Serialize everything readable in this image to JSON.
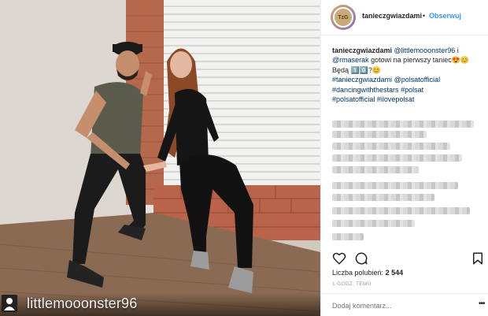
{
  "post": {
    "username": "tanieczgwiazdami",
    "dot": "•",
    "follow_label": "Obserwuj",
    "avatar_text": "TzG"
  },
  "caption": {
    "username": "tanieczgwiazdami",
    "mention1": "@littlemooonster96",
    "text1": " i ",
    "mention2": "@rmaserak",
    "text2": " gotowi na pierwszy taniec😍😊",
    "text3": "Będą 1️⃣0️⃣?😊",
    "tag1": "#tanieczgwiazdami",
    "tag2": "@polsatofficial",
    "tag3": "#dancingwiththestars",
    "tag4": "#polsat",
    "tag5": "#polsatofficial",
    "tag6": "#ilovepolsat"
  },
  "stats": {
    "likes_label": "Liczba polubień: ",
    "likes_count": "2 544",
    "time": "1 GODZ. TEMU"
  },
  "comment": {
    "placeholder": "Dodaj komentarz..."
  },
  "watermark": {
    "handle": "littlemooonster96"
  },
  "icons": {
    "like": "heart-outline-icon",
    "comment": "speech-bubble-icon",
    "save": "bookmark-icon",
    "more": "ellipsis-icon",
    "watermark": "user-silhouette-icon"
  }
}
